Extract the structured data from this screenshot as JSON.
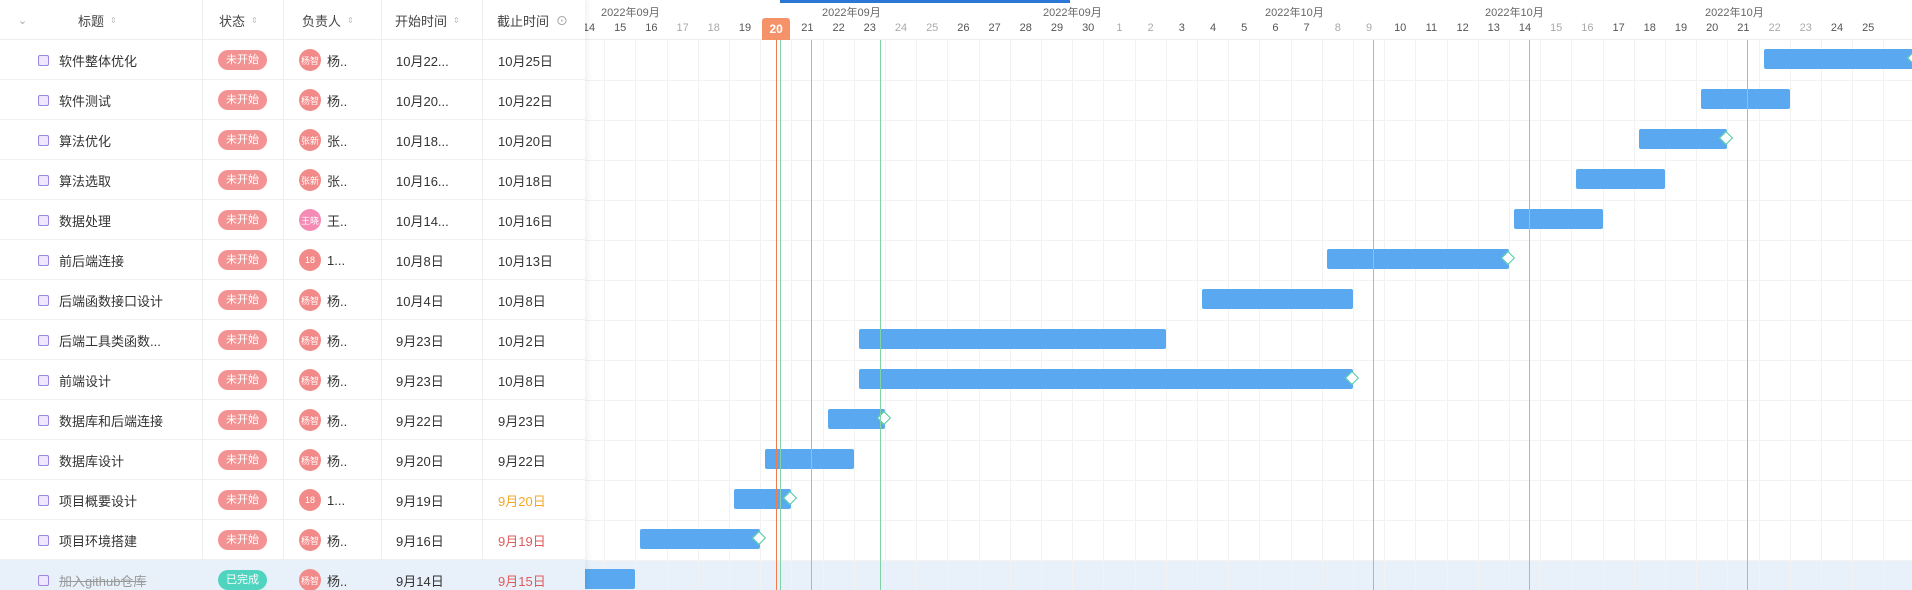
{
  "columns": {
    "title": "标题",
    "status": "状态",
    "owner": "负责人",
    "start": "开始时间",
    "end": "截止时间"
  },
  "tasks": [
    {
      "title": "软件整体优化",
      "status": "未开始",
      "avatar_text": "杨智",
      "owner": "杨..",
      "start": "10月22...",
      "end": "10月25日",
      "end_color": "#333333",
      "done": false,
      "avatar_color": "#f28a8a"
    },
    {
      "title": "软件测试",
      "status": "未开始",
      "avatar_text": "杨智",
      "owner": "杨..",
      "start": "10月20...",
      "end": "10月22日",
      "end_color": "#333333",
      "done": false,
      "avatar_color": "#f28a8a"
    },
    {
      "title": "算法优化",
      "status": "未开始",
      "avatar_text": "张新",
      "owner": "张..",
      "start": "10月18...",
      "end": "10月20日",
      "end_color": "#333333",
      "done": false,
      "avatar_color": "#f28a8a"
    },
    {
      "title": "算法选取",
      "status": "未开始",
      "avatar_text": "张新",
      "owner": "张..",
      "start": "10月16...",
      "end": "10月18日",
      "end_color": "#333333",
      "done": false,
      "avatar_color": "#f28a8a"
    },
    {
      "title": "数据处理",
      "status": "未开始",
      "avatar_text": "王晓",
      "owner": "王..",
      "start": "10月14...",
      "end": "10月16日",
      "end_color": "#333333",
      "done": false,
      "avatar_color": "#f58ab5"
    },
    {
      "title": "前后端连接",
      "status": "未开始",
      "avatar_text": "18",
      "owner": "1...",
      "start": "10月8日",
      "end": "10月13日",
      "end_color": "#333333",
      "done": false,
      "avatar_color": "#f28a8a"
    },
    {
      "title": "后端函数接口设计",
      "status": "未开始",
      "avatar_text": "杨智",
      "owner": "杨..",
      "start": "10月4日",
      "end": "10月8日",
      "end_color": "#333333",
      "done": false,
      "avatar_color": "#f28a8a"
    },
    {
      "title": "后端工具类函数...",
      "status": "未开始",
      "avatar_text": "杨智",
      "owner": "杨..",
      "start": "9月23日",
      "end": "10月2日",
      "end_color": "#333333",
      "done": false,
      "avatar_color": "#f28a8a"
    },
    {
      "title": "前端设计",
      "status": "未开始",
      "avatar_text": "杨智",
      "owner": "杨..",
      "start": "9月23日",
      "end": "10月8日",
      "end_color": "#333333",
      "done": false,
      "avatar_color": "#f28a8a"
    },
    {
      "title": "数据库和后端连接",
      "status": "未开始",
      "avatar_text": "杨智",
      "owner": "杨..",
      "start": "9月22日",
      "end": "9月23日",
      "end_color": "#333333",
      "done": false,
      "avatar_color": "#f28a8a"
    },
    {
      "title": "数据库设计",
      "status": "未开始",
      "avatar_text": "杨智",
      "owner": "杨..",
      "start": "9月20日",
      "end": "9月22日",
      "end_color": "#333333",
      "done": false,
      "avatar_color": "#f28a8a"
    },
    {
      "title": "项目概要设计",
      "status": "未开始",
      "avatar_text": "18",
      "owner": "1...",
      "start": "9月19日",
      "end": "9月20日",
      "end_color": "#f5a623",
      "done": false,
      "avatar_color": "#f28a8a"
    },
    {
      "title": "项目环境搭建",
      "status": "未开始",
      "avatar_text": "杨智",
      "owner": "杨..",
      "start": "9月16日",
      "end": "9月19日",
      "end_color": "#e05a5a",
      "done": false,
      "avatar_color": "#f28a8a"
    },
    {
      "title": "加入github仓库",
      "status": "已完成",
      "avatar_text": "杨智",
      "owner": "杨..",
      "start": "9月14日",
      "end": "9月15日",
      "end_color": "#e05a5a",
      "done": true,
      "avatar_color": "#f28a8a"
    }
  ],
  "timeline": {
    "months": [
      "2022年09月",
      "2022年09月",
      "2022年09月",
      "2022年10月",
      "2022年10月",
      "2022年10月"
    ],
    "days": [
      14,
      15,
      16,
      17,
      18,
      19,
      20,
      21,
      22,
      23,
      24,
      25,
      26,
      27,
      28,
      29,
      30,
      1,
      2,
      3,
      4,
      5,
      6,
      7,
      8,
      9,
      10,
      11,
      12,
      13,
      14,
      15,
      16,
      17,
      18,
      19,
      20,
      21,
      22,
      23,
      24,
      25
    ],
    "today": "20"
  }
}
